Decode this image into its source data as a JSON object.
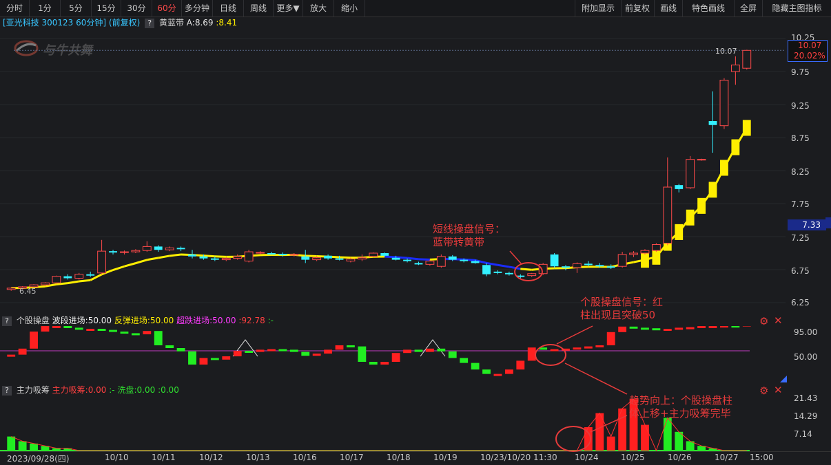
{
  "toolbar": {
    "left": [
      "分时",
      "1分",
      "5分",
      "15分",
      "30分",
      "60分",
      "多分钟",
      "日线",
      "周线",
      "更多▼",
      "放大",
      "缩小"
    ],
    "active": "60分",
    "right": [
      "附加显示",
      "前复权",
      "画线",
      "特色画线",
      "全屏",
      "隐藏主图指标"
    ]
  },
  "main_title": {
    "stock": "[亚光科技 300123 60分钟]",
    "adjust": "(前复权)",
    "q": "?",
    "indicator": "黄蓝带",
    "a_value": "A:8.69",
    "b_value": ":8.41"
  },
  "watermark": "与牛共舞",
  "price_axis": {
    "ticks": [
      "10.25",
      "9.75",
      "9.25",
      "8.75",
      "8.25",
      "7.75",
      "7.25",
      "6.75",
      "6.25"
    ],
    "current_price": "10.07",
    "current_pct": "20.02%",
    "last_label": "10.07",
    "marker": "7.33",
    "low_label": "6.45"
  },
  "ind1": {
    "q": "?",
    "name": "个股操盘",
    "p1": "波段进场:50.00",
    "p2": "反弹进场:50.00",
    "p3": "超跌进场:50.00",
    "p4": ":92.78",
    "p5": ":-",
    "ticks": [
      "95.00",
      "50.00"
    ]
  },
  "ind2": {
    "q": "?",
    "name": "主力吸筹",
    "p1": "主力吸筹:0.00",
    "p2": ":-",
    "p3": "洗盘:0.00",
    "p4": ":0.00",
    "ticks": [
      "21.43",
      "14.29",
      "7.14"
    ]
  },
  "dates": [
    "2023/09/28(四)",
    "10/10",
    "10/11",
    "10/12",
    "10/13",
    "10/16",
    "10/17",
    "10/18",
    "10/19",
    "10/23/10/20 11:30",
    "10/24",
    "10/25",
    "10/26",
    "10/27",
    "15:00"
  ],
  "annotations": {
    "a1_line1": "短线操盘信号：",
    "a1_line2": "蓝带转黄带",
    "a2_line1": "个股操盘信号：红",
    "a2_line2": "柱出现且突破50",
    "a3_line1": "趋势向上：个股操盘柱",
    "a3_line2": "体上移+主力吸筹完毕"
  },
  "chart_data": {
    "type": "candlestick",
    "ylim": [
      6.25,
      10.25
    ],
    "candles": [
      [
        6.45,
        6.48,
        6.43,
        6.47
      ],
      [
        6.47,
        6.5,
        6.45,
        6.49
      ],
      [
        6.49,
        6.53,
        6.48,
        6.52
      ],
      [
        6.52,
        6.56,
        6.5,
        6.55
      ],
      [
        6.55,
        6.66,
        6.54,
        6.65
      ],
      [
        6.65,
        6.68,
        6.6,
        6.62
      ],
      [
        6.62,
        6.7,
        6.6,
        6.68
      ],
      [
        6.68,
        6.72,
        6.64,
        6.66
      ],
      [
        6.7,
        7.2,
        6.68,
        7.03
      ],
      [
        7.03,
        7.05,
        6.98,
        7.01
      ],
      [
        7.01,
        7.04,
        6.98,
        7.02
      ],
      [
        7.02,
        7.06,
        7.0,
        7.04
      ],
      [
        7.04,
        7.18,
        7.02,
        7.1
      ],
      [
        7.1,
        7.12,
        7.02,
        7.05
      ],
      [
        7.05,
        7.1,
        7.03,
        7.08
      ],
      [
        7.08,
        7.1,
        7.03,
        7.06
      ],
      [
        6.98,
        7.05,
        6.92,
        6.95
      ],
      [
        6.95,
        6.98,
        6.9,
        6.92
      ],
      [
        6.92,
        6.95,
        6.88,
        6.9
      ],
      [
        6.9,
        6.94,
        6.88,
        6.92
      ],
      [
        6.92,
        6.98,
        6.9,
        6.95
      ],
      [
        6.88,
        7.05,
        6.86,
        7.02
      ],
      [
        7.0,
        7.03,
        6.98,
        7.01
      ],
      [
        7.0,
        7.02,
        6.98,
        6.99
      ],
      [
        6.99,
        7.01,
        6.95,
        6.97
      ],
      [
        6.97,
        7.0,
        6.95,
        6.98
      ],
      [
        6.95,
        7.05,
        6.85,
        6.9
      ],
      [
        6.9,
        6.95,
        6.88,
        6.93
      ],
      [
        6.96,
        6.98,
        6.9,
        6.92
      ],
      [
        6.92,
        6.96,
        6.89,
        6.9
      ],
      [
        6.88,
        6.93,
        6.86,
        6.91
      ],
      [
        6.91,
        6.98,
        6.88,
        6.93
      ],
      [
        6.95,
        7.01,
        6.94,
        7.0
      ],
      [
        7.0,
        7.01,
        6.95,
        6.96
      ],
      [
        6.93,
        6.96,
        6.89,
        6.9
      ],
      [
        6.9,
        6.92,
        6.86,
        6.88
      ],
      [
        6.85,
        6.87,
        6.82,
        6.83
      ],
      [
        6.83,
        6.9,
        6.81,
        6.88
      ],
      [
        6.8,
        6.98,
        6.78,
        6.95
      ],
      [
        6.95,
        6.97,
        6.88,
        6.9
      ],
      [
        6.9,
        6.92,
        6.86,
        6.88
      ],
      [
        6.88,
        6.9,
        6.84,
        6.85
      ],
      [
        6.82,
        6.85,
        6.65,
        6.68
      ],
      [
        6.72,
        6.74,
        6.68,
        6.7
      ],
      [
        6.7,
        6.72,
        6.66,
        6.68
      ],
      [
        6.66,
        6.68,
        6.62,
        6.64
      ],
      [
        6.66,
        6.7,
        6.64,
        6.69
      ],
      [
        6.69,
        6.85,
        6.67,
        6.83
      ],
      [
        6.98,
        7.0,
        6.78,
        6.8
      ],
      [
        6.8,
        6.82,
        6.74,
        6.78
      ],
      [
        6.78,
        6.86,
        6.7,
        6.84
      ],
      [
        6.84,
        6.88,
        6.8,
        6.82
      ],
      [
        6.82,
        6.85,
        6.78,
        6.8
      ],
      [
        6.8,
        6.83,
        6.76,
        6.78
      ],
      [
        6.8,
        7.02,
        6.78,
        6.98
      ],
      [
        6.98,
        7.03,
        6.94,
        7.0
      ],
      [
        7.0,
        7.06,
        6.98,
        7.04
      ],
      [
        7.04,
        7.15,
        7.02,
        7.13
      ],
      [
        7.15,
        8.45,
        7.12,
        8.0
      ],
      [
        8.03,
        8.05,
        7.92,
        7.97
      ],
      [
        7.99,
        8.47,
        7.97,
        8.42
      ],
      [
        8.41,
        8.43,
        8.4,
        8.42
      ],
      [
        9.0,
        9.45,
        8.52,
        8.94
      ],
      [
        8.93,
        9.65,
        8.88,
        9.62
      ],
      [
        9.75,
        9.98,
        9.55,
        9.85
      ],
      [
        9.8,
        10.08,
        9.78,
        10.07
      ]
    ],
    "ind1_values": [
      43,
      54,
      85,
      95,
      95,
      92,
      90,
      90,
      88,
      85,
      82,
      80,
      86,
      60,
      55,
      49,
      25,
      37,
      34,
      40,
      50,
      48,
      52,
      53,
      52,
      48,
      41,
      45,
      52,
      60,
      58,
      30,
      25,
      30,
      46,
      52,
      48,
      54,
      49,
      37,
      28,
      16,
      8,
      8,
      16,
      32,
      56,
      52,
      53,
      54,
      56,
      58,
      60,
      84,
      94,
      92,
      91,
      88,
      90,
      92,
      93,
      95,
      95,
      96,
      95,
      98
    ],
    "ind2_values": [
      6,
      4,
      3,
      2,
      1,
      1,
      0,
      0,
      0,
      0,
      0,
      0,
      0,
      0,
      0,
      0,
      0,
      0,
      0,
      0,
      0,
      0,
      0,
      0,
      0,
      0,
      0,
      0,
      0,
      0,
      0,
      0,
      0,
      0,
      0,
      0,
      0,
      0,
      0,
      0,
      0,
      0,
      0,
      0,
      0,
      0,
      0,
      0,
      0,
      0,
      0,
      10,
      16,
      6,
      18,
      22,
      11,
      0,
      14,
      8,
      4,
      2,
      1,
      0,
      0,
      0
    ]
  }
}
